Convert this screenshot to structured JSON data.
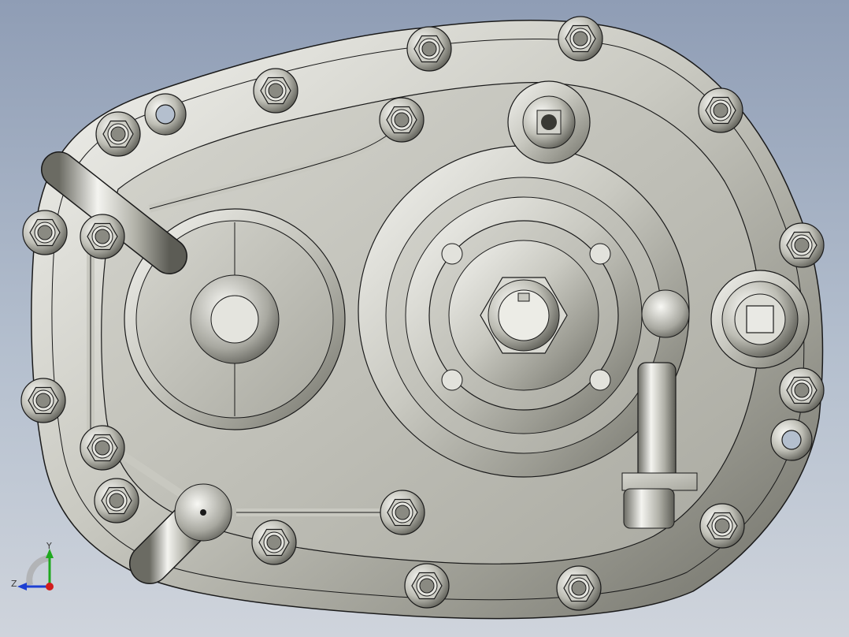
{
  "viewport": {
    "model_name": "gearbox-housing-cover"
  },
  "triad": {
    "x_label": "",
    "y_label": "Y",
    "z_label": "Z",
    "colors": {
      "x": "#d21c1c",
      "y": "#1fa81f",
      "z": "#1c3fd2"
    }
  },
  "colors": {
    "background_top": "#8f9db5",
    "background_bottom": "#cfd4dc",
    "metal_light": "#eeeeea",
    "metal_mid": "#b9b9b0",
    "metal_dark": "#5a5a52",
    "edge_line": "#1a1a1a"
  }
}
